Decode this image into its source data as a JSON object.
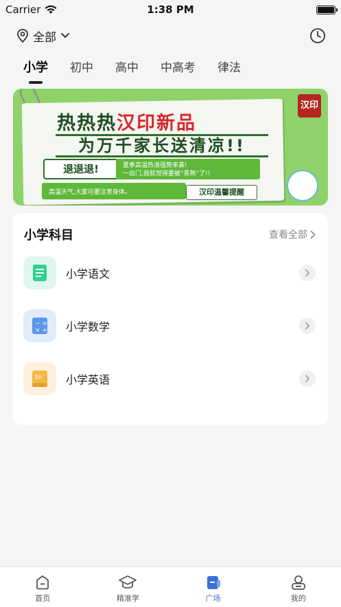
{
  "status_bar": {
    "carrier": "Carrier",
    "time": "1:38 PM"
  },
  "topbar": {
    "location_label": "全部"
  },
  "grade_tabs": [
    {
      "label": "小学",
      "active": true
    },
    {
      "label": "初中",
      "active": false
    },
    {
      "label": "高中",
      "active": false
    },
    {
      "label": "中高考",
      "active": false
    },
    {
      "label": "律法",
      "active": false
    }
  ],
  "banner": {
    "title_left": "热热热",
    "title_right": "汉印新品",
    "subtitle": "为万千家长送清凉!!",
    "tag_retreat": "退退退!",
    "note_line1": "夏季高温热浪强势来袭!",
    "note_line2": "一出门,我就觉得要被“蒸熟”了!!",
    "note_hot": "高温天气,大家可要注意身体。",
    "reminder": "汉印温馨提醒",
    "logo": "汉印"
  },
  "subjects_card": {
    "title": "小学科目",
    "see_all": "查看全部",
    "items": [
      {
        "label": "小学语文",
        "icon": "book-icon",
        "bg": "#dff7ee",
        "fg": "#2fcf90"
      },
      {
        "label": "小学数学",
        "icon": "calculator-icon",
        "bg": "#e0ecfb",
        "fg": "#5a98e8"
      },
      {
        "label": "小学英语",
        "icon": "english-book-icon",
        "bg": "#fdf1dd",
        "fg": "#f4b846"
      }
    ]
  },
  "tabbar": {
    "items": [
      {
        "label": "首页",
        "icon": "home-icon",
        "active": false
      },
      {
        "label": "精准学",
        "icon": "graduation-cap-icon",
        "active": false
      },
      {
        "label": "广场",
        "icon": "square-icon",
        "active": true
      },
      {
        "label": "我的",
        "icon": "profile-icon",
        "active": false
      }
    ]
  },
  "colors": {
    "accent": "#3a6fd8",
    "banner_bg": "#8fd26a"
  }
}
